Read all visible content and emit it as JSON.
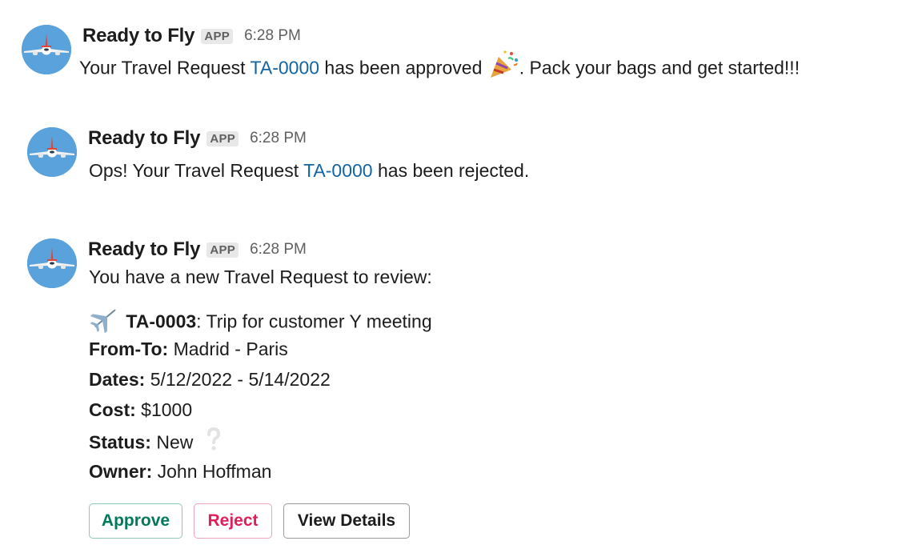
{
  "messages": [
    {
      "sender": "Ready to Fly",
      "badge": "APP",
      "time": "6:28 PM",
      "text_before": "Your Travel Request ",
      "link": "TA-0000",
      "text_middle": " has been approved ",
      "emoji": "party-popper-icon",
      "text_after": ". Pack your bags and get started!!!"
    },
    {
      "sender": "Ready to Fly",
      "badge": "APP",
      "time": "6:28 PM",
      "text_before": "Ops! Your Travel Request ",
      "link": "TA-0000",
      "text_after": " has been rejected."
    },
    {
      "sender": "Ready to Fly",
      "badge": "APP",
      "time": "6:28 PM",
      "intro": "You have a new Travel Request to review:",
      "request": {
        "icon": "airplane-icon",
        "id": "TA-0003",
        "title": ": Trip for customer Y meeting",
        "from_to_label": "From-To:",
        "from_to": " Madrid - Paris",
        "dates_label": "Dates:",
        "dates": " 5/12/2022 - 5/14/2022",
        "cost_label": "Cost:",
        "cost": " $1000",
        "status_label": "Status:",
        "status": " New",
        "status_icon": "white-question-mark-icon",
        "owner_label": "Owner:",
        "owner": " John Hoffman"
      },
      "actions": {
        "approve": "Approve",
        "reject": "Reject",
        "view": "View Details"
      }
    }
  ],
  "colors": {
    "link": "#1264a3",
    "approve": "#007a5a",
    "reject": "#e01e5a",
    "avatar_bg": "#5aa2dc"
  }
}
